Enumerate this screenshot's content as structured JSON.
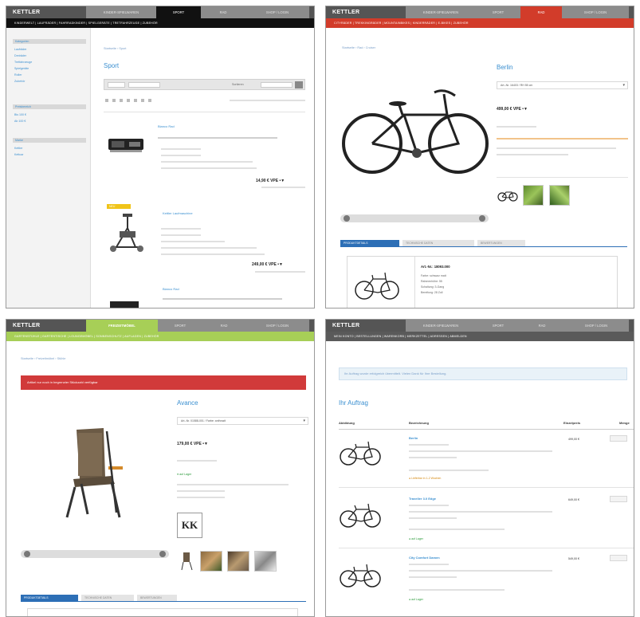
{
  "brand": "KETTLER",
  "panel1": {
    "tabs": [
      "KINDER-SPIELWAREN",
      "SPORT",
      "RAD",
      "SHOP / LOGIN"
    ],
    "nav": "KINDERWELT  |  LAUFRÄDER  |  FAHRRADKINDER  |  SPIELGERÄTE  |  TRETFAHRZEUGE  |  ZUBEHÖR",
    "sidebar_heads": [
      "Kategorien",
      "Preisbereich",
      "Marke"
    ],
    "sidebar_items": [
      "Laufräder",
      "Dreiräder",
      "Tretfahrzeuge",
      "Spielgeräte",
      "Roller",
      "Zubehör",
      "Bis 100 €",
      "Ab 100 €",
      "Kettler",
      "Kettcar"
    ],
    "crumb": "Startseite › Sport",
    "title": "Sport",
    "sort_label": "Sortieren",
    "products": [
      {
        "name": "Bianco Rad",
        "price": "14,90 €  VPE  •▼"
      },
      {
        "name": "Kettler Laufmaschine",
        "price": "249,00 €  VPE  •▼",
        "badge": "NEU"
      },
      {
        "name": "Bianco Rad",
        "price": ""
      }
    ]
  },
  "panel2": {
    "tabs": [
      "KINDER-SPIELWAREN",
      "SPORT",
      "RAD",
      "SHOP / LOGIN"
    ],
    "nav": "CITYRÄDER  |  TREKKINGRÄDER  |  MOUNTAINBIKES  |  KINDERRÄDER  |  E-BIKES  |  ZUBEHÖR",
    "crumb": "Startseite › Rad › Cruiser",
    "title": "Berlin",
    "select": "Art.-Nr. 16403 / RH 55 cm",
    "price": "499,00 €  VPE  •▼",
    "tabs_bottom": [
      "PRODUKTDETAILS",
      "TECHNISCHE DATEN",
      "BEWERTUNGEN"
    ],
    "artno": "Art.-Nr.: 18093.000",
    "specs": [
      "Farbe: schwarz matt",
      "Rahmenhöhe: 55",
      "Schaltung: 3-Gang",
      "Bereifung: 28 Zoll"
    ]
  },
  "panel3": {
    "tabs": [
      "FREIZEITMÖBEL",
      "SPORT",
      "RAD",
      "SHOP / LOGIN"
    ],
    "nav": "GARTENSTÜHLE  |  GARTENTISCHE  |  LOUNGEMÖBEL  |  SONNENSCHUTZ  |  AUFLAGEN  |  ZUBEHÖR",
    "crumb": "Startseite › Freizeitmöbel › Stühle",
    "alert": "Artikel nur noch in begrenzter Stückzahl verfügbar",
    "title": "Avance",
    "select": "Art.-Nr. 01588-001 / Farbe: anthrazit",
    "price": "179,00 €  VPE  •▼",
    "stock": "auf Lager",
    "logo": "KK",
    "tabs_bottom": [
      "PRODUKTDETAILS",
      "TECHNISCHE DATEN",
      "BEWERTUNGEN"
    ]
  },
  "panel4": {
    "tabs": [
      "KINDER-SPIELWAREN",
      "SPORT",
      "RAD",
      "SHOP / LOGIN"
    ],
    "nav": "MEIN KONTO  |  BESTELLUNGEN  |  WARENKORB  |  MERKZETTEL  |  ADRESSEN  |  ABMELDEN",
    "info": "Ihr Auftrag wurde erfolgreich übermittelt. Vielen Dank für Ihre Bestellung.",
    "title": "Ihr Auftrag",
    "headers": [
      "Abbildung",
      "Bezeichnung",
      "Einzelpreis",
      "Menge"
    ],
    "items": [
      {
        "name": "Berlin",
        "price": "499,00 €",
        "status": "Lieferbar in 1-2 Wochen"
      },
      {
        "name": "Traveller 3.0 Edge",
        "price": "649,00 €",
        "status": "auf Lager"
      },
      {
        "name": "City Comfort Damen",
        "price": "549,00 €",
        "status": "auf Lager"
      }
    ]
  },
  "colors": {
    "panel1_nav": "#111111",
    "panel2_nav": "#d23c2a",
    "panel3_nav": "#a7cf57",
    "panel4_nav": "#5a5a5a",
    "accent": "#3a8fd0"
  }
}
